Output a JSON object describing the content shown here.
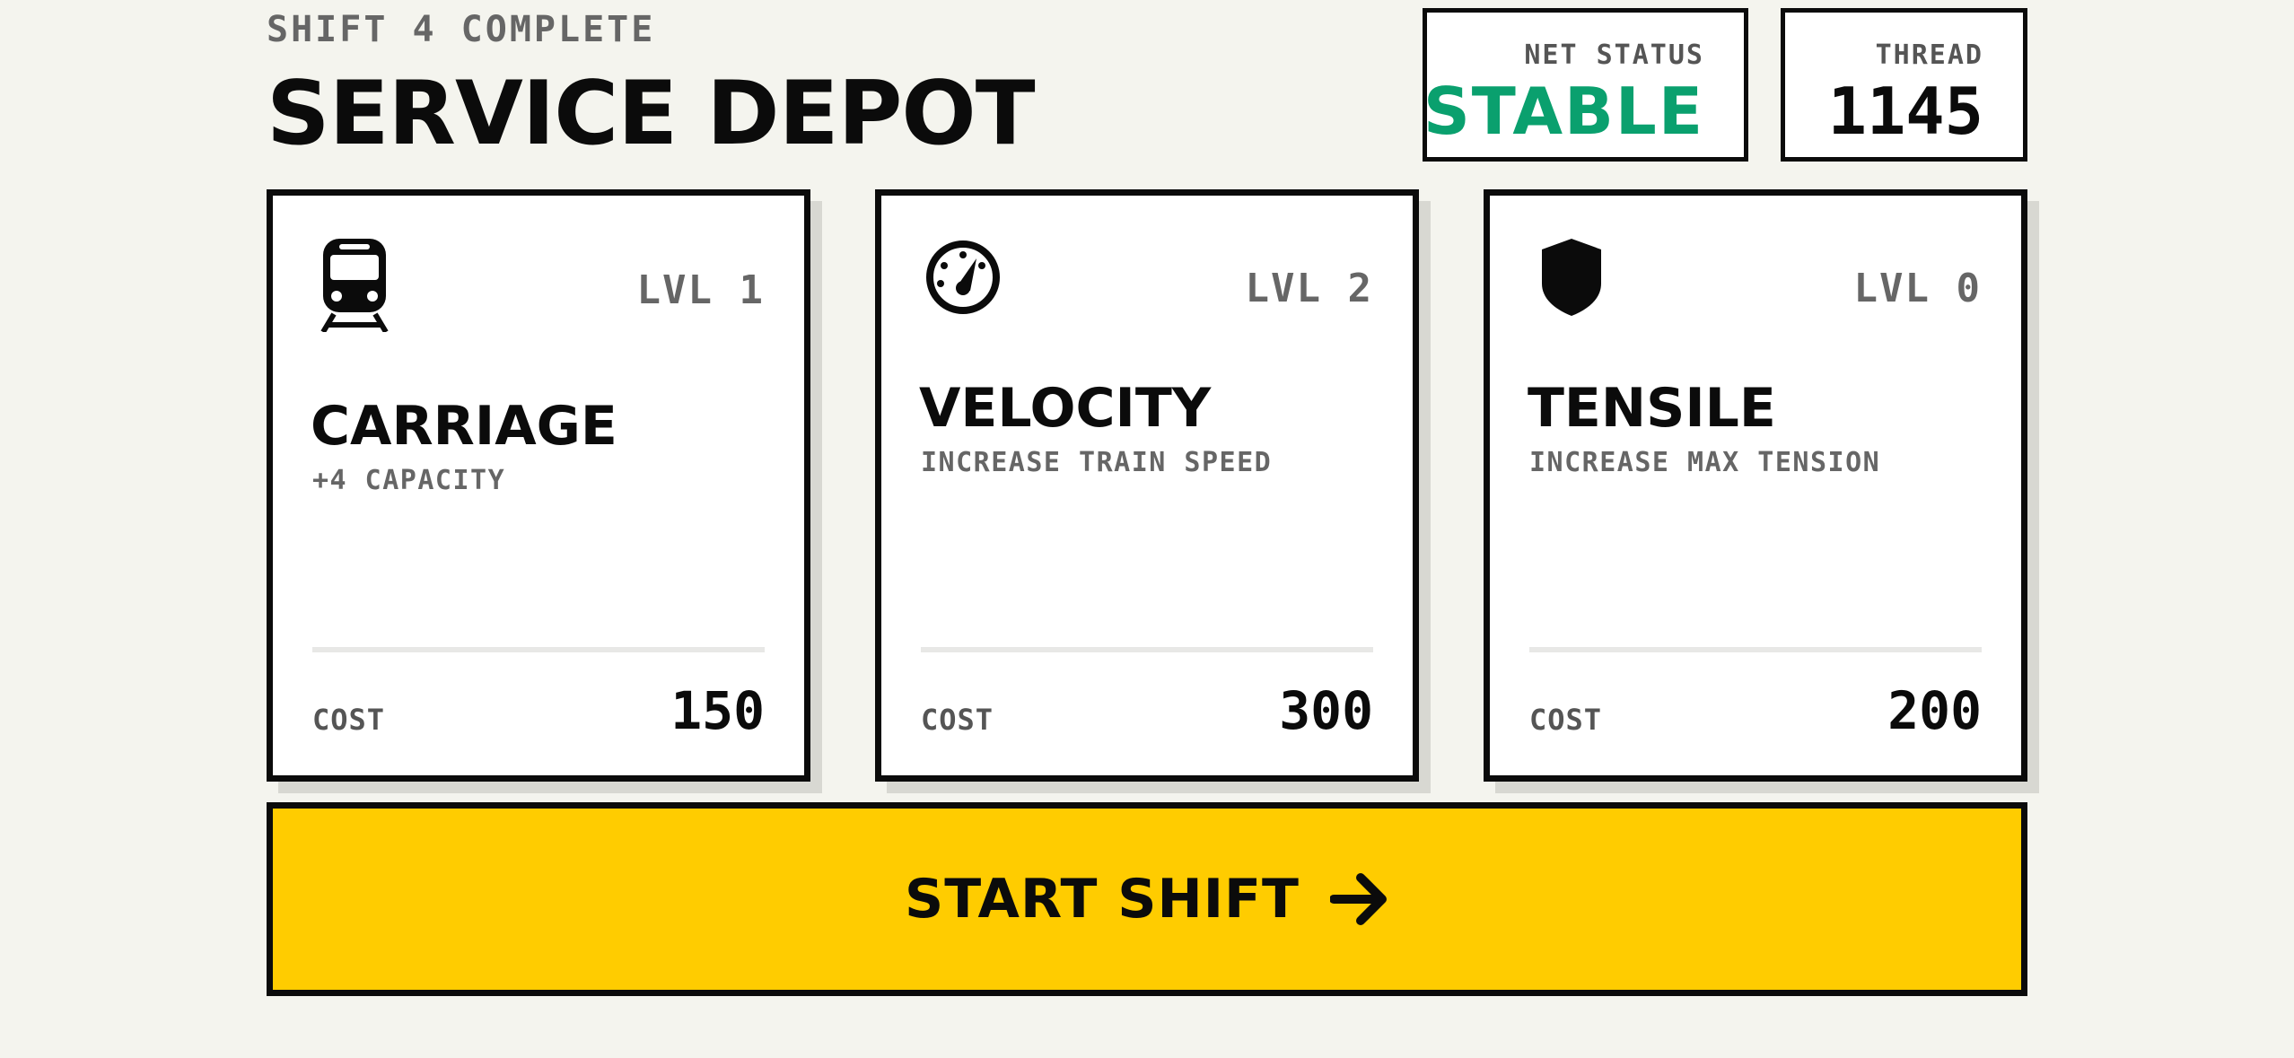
{
  "header": {
    "eyebrow": "SHIFT 4 COMPLETE",
    "title": "SERVICE DEPOT"
  },
  "stats": {
    "net_status": {
      "label": "NET STATUS",
      "value": "STABLE",
      "color": "#0aa06e"
    },
    "thread": {
      "label": "THREAD",
      "value": "1145"
    }
  },
  "upgrades": [
    {
      "icon": "train-icon",
      "level": "LVL 1",
      "name": "CARRIAGE",
      "description": "+4 CAPACITY",
      "cost_label": "COST",
      "cost": "150"
    },
    {
      "icon": "speedometer-icon",
      "level": "LVL 2",
      "name": "VELOCITY",
      "description": "INCREASE TRAIN SPEED",
      "cost_label": "COST",
      "cost": "300"
    },
    {
      "icon": "shield-icon",
      "level": "LVL 0",
      "name": "TENSILE",
      "description": "INCREASE MAX TENSION",
      "cost_label": "COST",
      "cost": "200"
    }
  ],
  "action": {
    "label": "START SHIFT",
    "icon": "arrow-right-icon",
    "color": "#ffcc00"
  }
}
